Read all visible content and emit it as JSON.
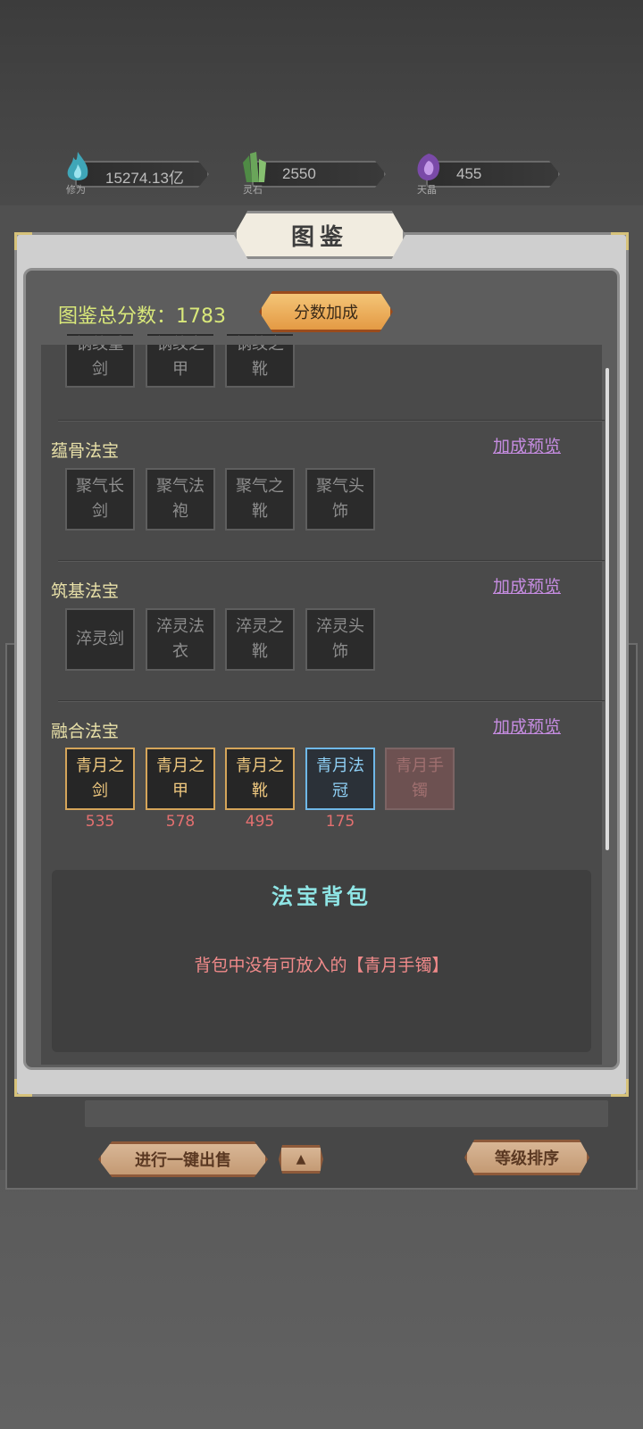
{
  "resources": [
    {
      "label": "修为",
      "value": "15274.13亿",
      "icon": "cultivation-flame-icon",
      "color": "#3fa6b8"
    },
    {
      "label": "灵石",
      "value": "2550",
      "icon": "spirit-crystal-icon",
      "color": "#6aa55a"
    },
    {
      "label": "天晶",
      "value": "455",
      "icon": "celestial-crystal-icon",
      "color": "#8a5ab8"
    }
  ],
  "panel": {
    "title": "图鉴",
    "score_label": "图鉴总分数：1783",
    "bonus_button": "分数加成"
  },
  "top_partial": [
    "钢纹重剑",
    "钢纹之甲",
    "钢纹之靴"
  ],
  "sections": [
    {
      "title": "蕴骨法宝",
      "link": "加成预览",
      "items": [
        "聚气长剑",
        "聚气法袍",
        "聚气之靴",
        "聚气头饰"
      ]
    },
    {
      "title": "筑基法宝",
      "link": "加成预览",
      "items": [
        "淬灵剑",
        "淬灵法衣",
        "淬灵之靴",
        "淬灵头饰"
      ]
    },
    {
      "title": "融合法宝",
      "link": "加成预览",
      "items": [
        {
          "name": "青月之剑",
          "score": "535",
          "quality": "gold"
        },
        {
          "name": "青月之甲",
          "score": "578",
          "quality": "gold"
        },
        {
          "name": "青月之靴",
          "score": "495",
          "quality": "gold"
        },
        {
          "name": "青月法冠",
          "score": "175",
          "quality": "blue"
        },
        {
          "name": "青月手镯",
          "score": "",
          "quality": "locked"
        }
      ]
    }
  ],
  "bag": {
    "title": "法宝背包",
    "message": "背包中没有可放入的【青月手镯】"
  },
  "bottom_bar": {
    "sell_all": "进行一键出售",
    "up_arrow": "▲",
    "sort": "等级排序"
  },
  "colors": {
    "gold_border": "#d5a55a",
    "blue_border": "#6fb8e8",
    "score_text": "#d9e87a",
    "link_text": "#c58ce0",
    "bag_title": "#8fe6e6",
    "warning_text": "#f08a8a"
  }
}
